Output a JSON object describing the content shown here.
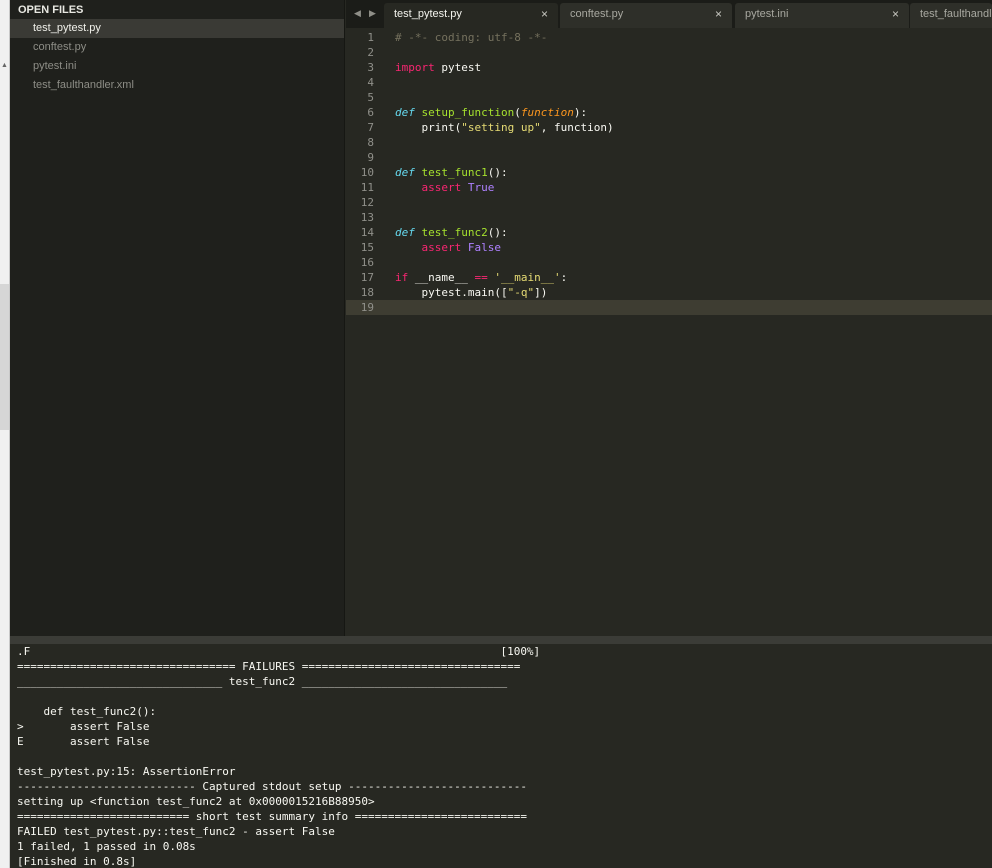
{
  "sidebar": {
    "header": "OPEN FILES",
    "files": [
      {
        "label": "test_pytest.py"
      },
      {
        "label": "conftest.py"
      },
      {
        "label": "pytest.ini"
      },
      {
        "label": "test_faulthandler.xml"
      }
    ]
  },
  "tabs": [
    {
      "label": "test_pytest.py",
      "close": "×"
    },
    {
      "label": "conftest.py",
      "close": "×"
    },
    {
      "label": "pytest.ini",
      "close": "×"
    },
    {
      "label": "test_faulthandler.xml"
    }
  ],
  "tab_nav": {
    "prev": "◀",
    "next": "▶"
  },
  "editor": {
    "current_line": 19,
    "lines": [
      {
        "n": "1",
        "tokens": [
          {
            "t": "# -*- coding: utf-8 -*-",
            "c": "cmt"
          }
        ]
      },
      {
        "n": "2",
        "tokens": []
      },
      {
        "n": "3",
        "tokens": [
          {
            "t": "import",
            "c": "kw"
          },
          {
            "t": " pytest",
            "c": ""
          }
        ]
      },
      {
        "n": "4",
        "tokens": []
      },
      {
        "n": "5",
        "tokens": []
      },
      {
        "n": "6",
        "tokens": [
          {
            "t": "def",
            "c": "def"
          },
          {
            "t": " ",
            "c": ""
          },
          {
            "t": "setup_function",
            "c": "fn"
          },
          {
            "t": "(",
            "c": ""
          },
          {
            "t": "function",
            "c": "param"
          },
          {
            "t": "):",
            "c": ""
          }
        ]
      },
      {
        "n": "7",
        "tokens": [
          {
            "t": "    print(",
            "c": ""
          },
          {
            "t": "\"setting up\"",
            "c": "str"
          },
          {
            "t": ", function)",
            "c": ""
          }
        ]
      },
      {
        "n": "8",
        "tokens": []
      },
      {
        "n": "9",
        "tokens": []
      },
      {
        "n": "10",
        "tokens": [
          {
            "t": "def",
            "c": "def"
          },
          {
            "t": " ",
            "c": ""
          },
          {
            "t": "test_func1",
            "c": "fn"
          },
          {
            "t": "():",
            "c": ""
          }
        ]
      },
      {
        "n": "11",
        "tokens": [
          {
            "t": "    ",
            "c": ""
          },
          {
            "t": "assert",
            "c": "kw"
          },
          {
            "t": " ",
            "c": ""
          },
          {
            "t": "True",
            "c": "const"
          }
        ]
      },
      {
        "n": "12",
        "tokens": []
      },
      {
        "n": "13",
        "tokens": []
      },
      {
        "n": "14",
        "tokens": [
          {
            "t": "def",
            "c": "def"
          },
          {
            "t": " ",
            "c": ""
          },
          {
            "t": "test_func2",
            "c": "fn"
          },
          {
            "t": "():",
            "c": ""
          }
        ]
      },
      {
        "n": "15",
        "tokens": [
          {
            "t": "    ",
            "c": ""
          },
          {
            "t": "assert",
            "c": "kw"
          },
          {
            "t": " ",
            "c": ""
          },
          {
            "t": "False",
            "c": "const"
          }
        ]
      },
      {
        "n": "16",
        "tokens": []
      },
      {
        "n": "17",
        "tokens": [
          {
            "t": "if",
            "c": "kw"
          },
          {
            "t": " __name__ ",
            "c": ""
          },
          {
            "t": "==",
            "c": "kw"
          },
          {
            "t": " ",
            "c": ""
          },
          {
            "t": "'__main__'",
            "c": "str"
          },
          {
            "t": ":",
            "c": ""
          }
        ]
      },
      {
        "n": "18",
        "tokens": [
          {
            "t": "    pytest.main([",
            "c": ""
          },
          {
            "t": "\"-q\"",
            "c": "str"
          },
          {
            "t": "])",
            "c": ""
          }
        ]
      },
      {
        "n": "19",
        "tokens": []
      }
    ]
  },
  "console": {
    "lines": [
      ".F                                                                       [100%]",
      "================================= FAILURES =================================",
      "_______________________________ test_func2 _______________________________",
      "",
      "    def test_func2():",
      ">       assert False",
      "E       assert False",
      "",
      "test_pytest.py:15: AssertionError",
      "--------------------------- Captured stdout setup ---------------------------",
      "setting up <function test_func2 at 0x0000015216B88950>",
      "========================== short test summary info ==========================",
      "FAILED test_pytest.py::test_func2 - assert False",
      "1 failed, 1 passed in 0.08s",
      "[Finished in 0.8s]"
    ]
  }
}
